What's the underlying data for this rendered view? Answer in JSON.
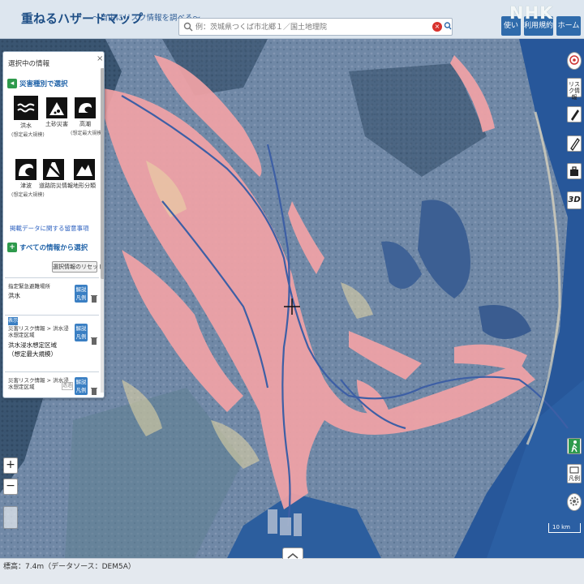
{
  "header": {
    "title": "重ねるハザードマップ",
    "subtitle": "〜自由にリスク情報を調べる〜",
    "search_placeholder": "例：茨城県つくば市北郷１／国土地理院",
    "clear_label": "×",
    "buttons": [
      "使い方",
      "利用規約",
      "ホーム"
    ],
    "logo": "NHK"
  },
  "panel": {
    "title": "選択中の情報",
    "close_label": "×",
    "by_type_label": "災害種別で選択",
    "hazards": [
      {
        "name": "洪水",
        "note": "(想定最大規模)",
        "icon": "flood-icon",
        "selected": true
      },
      {
        "name": "土砂災害",
        "note": "",
        "icon": "landslide-icon",
        "selected": false
      },
      {
        "name": "高潮",
        "note": "(想定最大規模)",
        "icon": "storm-surge-icon",
        "selected": false
      },
      {
        "name": "津波",
        "note": "(想定最大規模)",
        "icon": "tsunami-icon",
        "selected": false
      },
      {
        "name": "道路防災情報",
        "note": "",
        "icon": "road-disaster-icon",
        "selected": false
      },
      {
        "name": "地形分類",
        "note": "",
        "icon": "terrain-class-icon",
        "selected": false
      }
    ],
    "notes_link": "掲載データに関する留意事項",
    "all_info_label": "すべての情報から選択",
    "reset_label": "選択情報のリセット",
    "layers": [
      {
        "line1": "指定緊急避難場所",
        "line2": "洪水",
        "tag": "",
        "button": "解説\n凡例"
      },
      {
        "line1": "災害リスク情報 > 洪水浸",
        "line1b": "水想定区域",
        "big1": "洪水浸水想定区域",
        "big2": "（想定最大規模）",
        "tag": "表示",
        "button": "解説\n凡例"
      },
      {
        "line1": "災害リスク情報 > 洪水浸",
        "line1b": "水想定区域",
        "tag": "",
        "button": "解説\n凡例",
        "opacity_label": "透過"
      }
    ]
  },
  "right_toolbar": [
    "リスク情報",
    "3D",
    "凡例"
  ],
  "map": {
    "scale_label": "10 km",
    "colors": {
      "sea": "#27579a",
      "land": "#6f86a3",
      "inundation": "#f1a4a8",
      "river": "#3d5fa5",
      "forest": "#2d4f6e"
    }
  },
  "status": {
    "text": "標高：7.4m（データソース：DEM5A）"
  },
  "zoom": {
    "in": "+",
    "out": "−"
  }
}
